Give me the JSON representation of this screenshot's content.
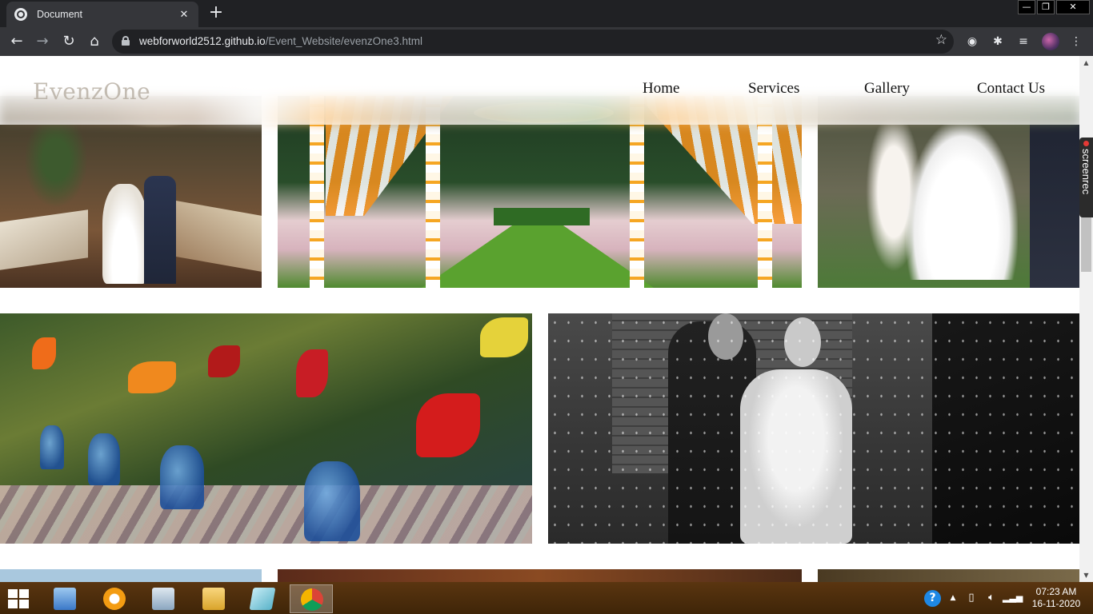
{
  "browser": {
    "tab_title": "Document",
    "tab_close": "✕",
    "new_tab": "+",
    "url_host": "webforworld2512.github.io",
    "url_path": "/Event_Website/evenzOne3.html",
    "window_controls": [
      "—",
      "❐",
      "✕"
    ]
  },
  "page": {
    "brand": "EvenzOne",
    "nav": [
      "Home",
      "Services",
      "Gallery",
      "Contact Us"
    ]
  },
  "screenrec": {
    "label": "screenrec"
  },
  "taskbar": {
    "time": "07:23 AM",
    "date": "16-11-2020",
    "help": "?"
  },
  "colors": {
    "chrome_dark": "#202124",
    "chrome_toolbar": "#35363a",
    "taskbar": "#4a2c0c",
    "nav_text": "#111111"
  }
}
